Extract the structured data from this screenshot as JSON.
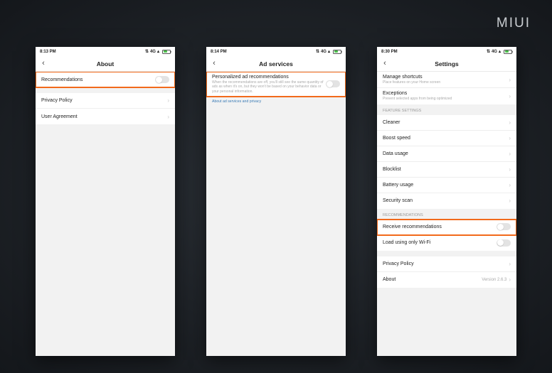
{
  "brand": "MIUI",
  "phone1": {
    "time": "8:13 PM",
    "signal": "4G",
    "title": "About",
    "rows": {
      "recommendations": "Recommendations",
      "privacy": "Privacy Policy",
      "agreement": "User Agreement"
    }
  },
  "phone2": {
    "time": "8:14 PM",
    "signal": "4G",
    "title": "Ad services",
    "row": {
      "title": "Personalized ad recommendations",
      "sub": "When the recommendations are off, you'll still see the same quantity of ads as when it's on, but they won't be based on your behavior data or your personal information."
    },
    "link": "About ad services and privacy"
  },
  "phone3": {
    "time": "8:30 PM",
    "signal": "4G",
    "title": "Settings",
    "rows": {
      "shortcuts_title": "Manage shortcuts",
      "shortcuts_sub": "Place features on your Home screen",
      "exceptions_title": "Exceptions",
      "exceptions_sub": "Prevent selected apps from being optimized",
      "section_feature": "FEATURE SETTINGS",
      "cleaner": "Cleaner",
      "boost": "Boost speed",
      "data": "Data usage",
      "blocklist": "Blocklist",
      "battery": "Battery usage",
      "security": "Security scan",
      "section_rec": "RECOMMENDATIONS",
      "receive_rec": "Receive recommendations",
      "wifi_only": "Load using only Wi-Fi",
      "privacy": "Privacy Policy",
      "about": "About",
      "about_value": "Version 2.6.3"
    }
  }
}
